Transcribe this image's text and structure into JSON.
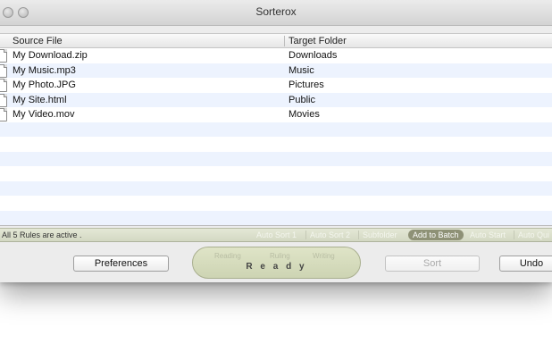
{
  "window": {
    "title": "Sorterox"
  },
  "table": {
    "headers": {
      "source": "Source File",
      "target": "Target Folder"
    },
    "rows": [
      {
        "source": "My Download.zip",
        "target": "Downloads"
      },
      {
        "source": "My Music.mp3",
        "target": "Music"
      },
      {
        "source": "My Photo.JPG",
        "target": "Pictures"
      },
      {
        "source": "My Site.html",
        "target": "Public"
      },
      {
        "source": "My Video.mov",
        "target": "Movies"
      }
    ]
  },
  "statusbar": {
    "text": "All 5 Rules are active .",
    "options": [
      {
        "label": "Auto Sort 1",
        "active": false
      },
      {
        "label": "Auto Sort 2",
        "active": false
      },
      {
        "label": "Subfolder",
        "active": false
      },
      {
        "label": "Add to Batch",
        "active": true
      },
      {
        "label": "Auto Start",
        "active": false
      },
      {
        "label": "Auto Qui",
        "active": false
      }
    ]
  },
  "bottom": {
    "preferences": "Preferences",
    "sort": "Sort",
    "undo": "Undo",
    "stages": [
      "Reading",
      "Ruling",
      "Writing"
    ],
    "state": "R e a d y"
  },
  "icons": {
    "file": "file-icon",
    "window_button": "window-button"
  }
}
